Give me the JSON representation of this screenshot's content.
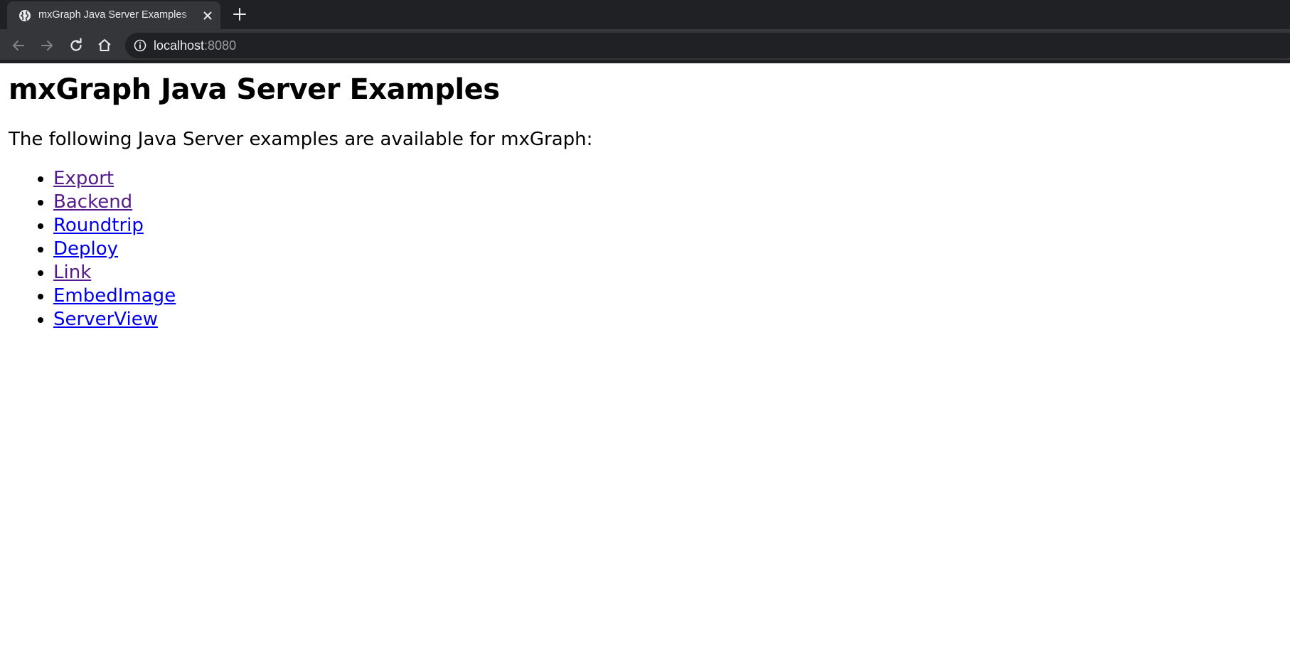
{
  "browser": {
    "tab": {
      "title": "mxGraph Java Server Examples",
      "favicon": "globe-icon"
    },
    "url": {
      "host": "localhost",
      "port": ":8080"
    },
    "icons": {
      "back": "arrow-left-icon",
      "forward": "arrow-right-icon",
      "reload": "reload-icon",
      "home": "home-icon",
      "info": "info-icon",
      "close": "close-icon",
      "new_tab": "plus-icon"
    },
    "colors": {
      "tab_strip": "#202124",
      "toolbar": "#35363a",
      "omnibox": "#202124"
    }
  },
  "page": {
    "title": "mxGraph Java Server Examples",
    "intro": "The following Java Server examples are available for mxGraph:",
    "links": [
      {
        "label": "Export",
        "visited": true
      },
      {
        "label": "Backend",
        "visited": true
      },
      {
        "label": "Roundtrip",
        "visited": false
      },
      {
        "label": "Deploy",
        "visited": false
      },
      {
        "label": "Link",
        "visited": true
      },
      {
        "label": "EmbedImage",
        "visited": false
      },
      {
        "label": "ServerView",
        "visited": false
      }
    ],
    "colors": {
      "link_visited": "#551a8b",
      "link_unvisited": "#0000ee"
    }
  }
}
